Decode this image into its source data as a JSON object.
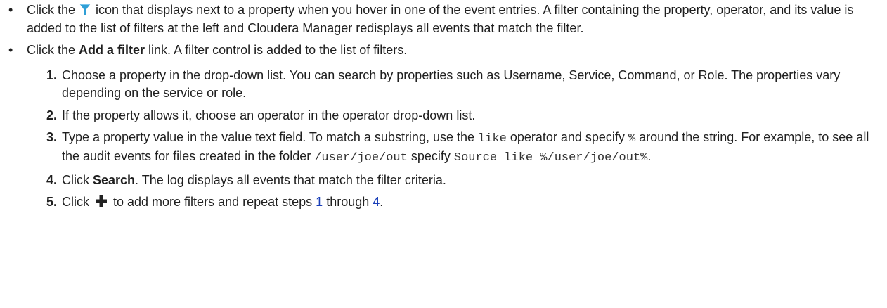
{
  "bullets": [
    {
      "symbol": "•",
      "pre": "Click the ",
      "icon": "filter-funnel-icon",
      "post": " icon that displays next to a property when you hover in one of the event entries. A filter containing the property, operator, and its value is added to the list of filters at the left and Cloudera Manager redisplays all events that match the filter."
    },
    {
      "symbol": "•",
      "pre": "Click the ",
      "bold": "Add a filter",
      "post": " link. A filter control is added to the list of filters."
    }
  ],
  "steps": [
    {
      "num": "1.",
      "text": "Choose a property in the drop-down list. You can search by properties such as Username, Service, Command, or Role. The properties vary depending on the service or role."
    },
    {
      "num": "2.",
      "text": "If the property allows it, choose an operator in the operator drop-down list."
    },
    {
      "num": "3.",
      "t1": "Type a property value in the value text field. To match a substring, use the ",
      "c1": "like",
      "t2": " operator and specify ",
      "c2": "%",
      "t3": " around the string. For example, to see all the audit events for files created in the folder ",
      "c3": "/user/joe/out",
      "t4": " specify ",
      "c4": "Source like %/user/joe/out%",
      "t5": "."
    },
    {
      "num": "4.",
      "pre": "Click ",
      "bold": "Search",
      "post": ". The log displays all events that match the filter criteria."
    },
    {
      "num": "5.",
      "pre": "Click ",
      "icon": "plus-icon",
      "mid": " to add more filters and repeat steps ",
      "link1": "1",
      "between": " through ",
      "link2": "4",
      "end": "."
    }
  ],
  "colors": {
    "text": "#1f1f1f",
    "link": "#1a3fb8",
    "funnel": "#2f9fd6",
    "plus": "#222222"
  }
}
